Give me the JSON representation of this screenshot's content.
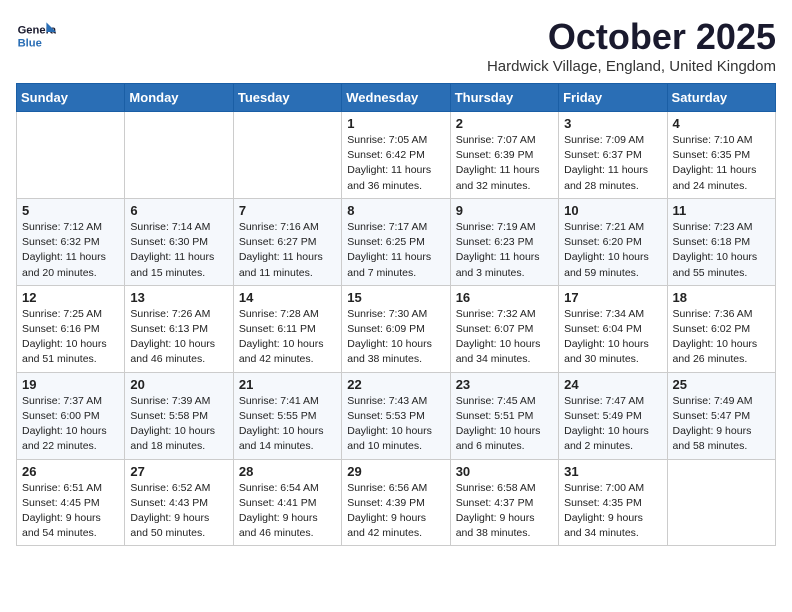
{
  "header": {
    "logo_line1": "General",
    "logo_line2": "Blue",
    "month": "October 2025",
    "location": "Hardwick Village, England, United Kingdom"
  },
  "days_of_week": [
    "Sunday",
    "Monday",
    "Tuesday",
    "Wednesday",
    "Thursday",
    "Friday",
    "Saturday"
  ],
  "weeks": [
    [
      {
        "day": "",
        "content": ""
      },
      {
        "day": "",
        "content": ""
      },
      {
        "day": "",
        "content": ""
      },
      {
        "day": "1",
        "content": "Sunrise: 7:05 AM\nSunset: 6:42 PM\nDaylight: 11 hours\nand 36 minutes."
      },
      {
        "day": "2",
        "content": "Sunrise: 7:07 AM\nSunset: 6:39 PM\nDaylight: 11 hours\nand 32 minutes."
      },
      {
        "day": "3",
        "content": "Sunrise: 7:09 AM\nSunset: 6:37 PM\nDaylight: 11 hours\nand 28 minutes."
      },
      {
        "day": "4",
        "content": "Sunrise: 7:10 AM\nSunset: 6:35 PM\nDaylight: 11 hours\nand 24 minutes."
      }
    ],
    [
      {
        "day": "5",
        "content": "Sunrise: 7:12 AM\nSunset: 6:32 PM\nDaylight: 11 hours\nand 20 minutes."
      },
      {
        "day": "6",
        "content": "Sunrise: 7:14 AM\nSunset: 6:30 PM\nDaylight: 11 hours\nand 15 minutes."
      },
      {
        "day": "7",
        "content": "Sunrise: 7:16 AM\nSunset: 6:27 PM\nDaylight: 11 hours\nand 11 minutes."
      },
      {
        "day": "8",
        "content": "Sunrise: 7:17 AM\nSunset: 6:25 PM\nDaylight: 11 hours\nand 7 minutes."
      },
      {
        "day": "9",
        "content": "Sunrise: 7:19 AM\nSunset: 6:23 PM\nDaylight: 11 hours\nand 3 minutes."
      },
      {
        "day": "10",
        "content": "Sunrise: 7:21 AM\nSunset: 6:20 PM\nDaylight: 10 hours\nand 59 minutes."
      },
      {
        "day": "11",
        "content": "Sunrise: 7:23 AM\nSunset: 6:18 PM\nDaylight: 10 hours\nand 55 minutes."
      }
    ],
    [
      {
        "day": "12",
        "content": "Sunrise: 7:25 AM\nSunset: 6:16 PM\nDaylight: 10 hours\nand 51 minutes."
      },
      {
        "day": "13",
        "content": "Sunrise: 7:26 AM\nSunset: 6:13 PM\nDaylight: 10 hours\nand 46 minutes."
      },
      {
        "day": "14",
        "content": "Sunrise: 7:28 AM\nSunset: 6:11 PM\nDaylight: 10 hours\nand 42 minutes."
      },
      {
        "day": "15",
        "content": "Sunrise: 7:30 AM\nSunset: 6:09 PM\nDaylight: 10 hours\nand 38 minutes."
      },
      {
        "day": "16",
        "content": "Sunrise: 7:32 AM\nSunset: 6:07 PM\nDaylight: 10 hours\nand 34 minutes."
      },
      {
        "day": "17",
        "content": "Sunrise: 7:34 AM\nSunset: 6:04 PM\nDaylight: 10 hours\nand 30 minutes."
      },
      {
        "day": "18",
        "content": "Sunrise: 7:36 AM\nSunset: 6:02 PM\nDaylight: 10 hours\nand 26 minutes."
      }
    ],
    [
      {
        "day": "19",
        "content": "Sunrise: 7:37 AM\nSunset: 6:00 PM\nDaylight: 10 hours\nand 22 minutes."
      },
      {
        "day": "20",
        "content": "Sunrise: 7:39 AM\nSunset: 5:58 PM\nDaylight: 10 hours\nand 18 minutes."
      },
      {
        "day": "21",
        "content": "Sunrise: 7:41 AM\nSunset: 5:55 PM\nDaylight: 10 hours\nand 14 minutes."
      },
      {
        "day": "22",
        "content": "Sunrise: 7:43 AM\nSunset: 5:53 PM\nDaylight: 10 hours\nand 10 minutes."
      },
      {
        "day": "23",
        "content": "Sunrise: 7:45 AM\nSunset: 5:51 PM\nDaylight: 10 hours\nand 6 minutes."
      },
      {
        "day": "24",
        "content": "Sunrise: 7:47 AM\nSunset: 5:49 PM\nDaylight: 10 hours\nand 2 minutes."
      },
      {
        "day": "25",
        "content": "Sunrise: 7:49 AM\nSunset: 5:47 PM\nDaylight: 9 hours\nand 58 minutes."
      }
    ],
    [
      {
        "day": "26",
        "content": "Sunrise: 6:51 AM\nSunset: 4:45 PM\nDaylight: 9 hours\nand 54 minutes."
      },
      {
        "day": "27",
        "content": "Sunrise: 6:52 AM\nSunset: 4:43 PM\nDaylight: 9 hours\nand 50 minutes."
      },
      {
        "day": "28",
        "content": "Sunrise: 6:54 AM\nSunset: 4:41 PM\nDaylight: 9 hours\nand 46 minutes."
      },
      {
        "day": "29",
        "content": "Sunrise: 6:56 AM\nSunset: 4:39 PM\nDaylight: 9 hours\nand 42 minutes."
      },
      {
        "day": "30",
        "content": "Sunrise: 6:58 AM\nSunset: 4:37 PM\nDaylight: 9 hours\nand 38 minutes."
      },
      {
        "day": "31",
        "content": "Sunrise: 7:00 AM\nSunset: 4:35 PM\nDaylight: 9 hours\nand 34 minutes."
      },
      {
        "day": "",
        "content": ""
      }
    ]
  ]
}
